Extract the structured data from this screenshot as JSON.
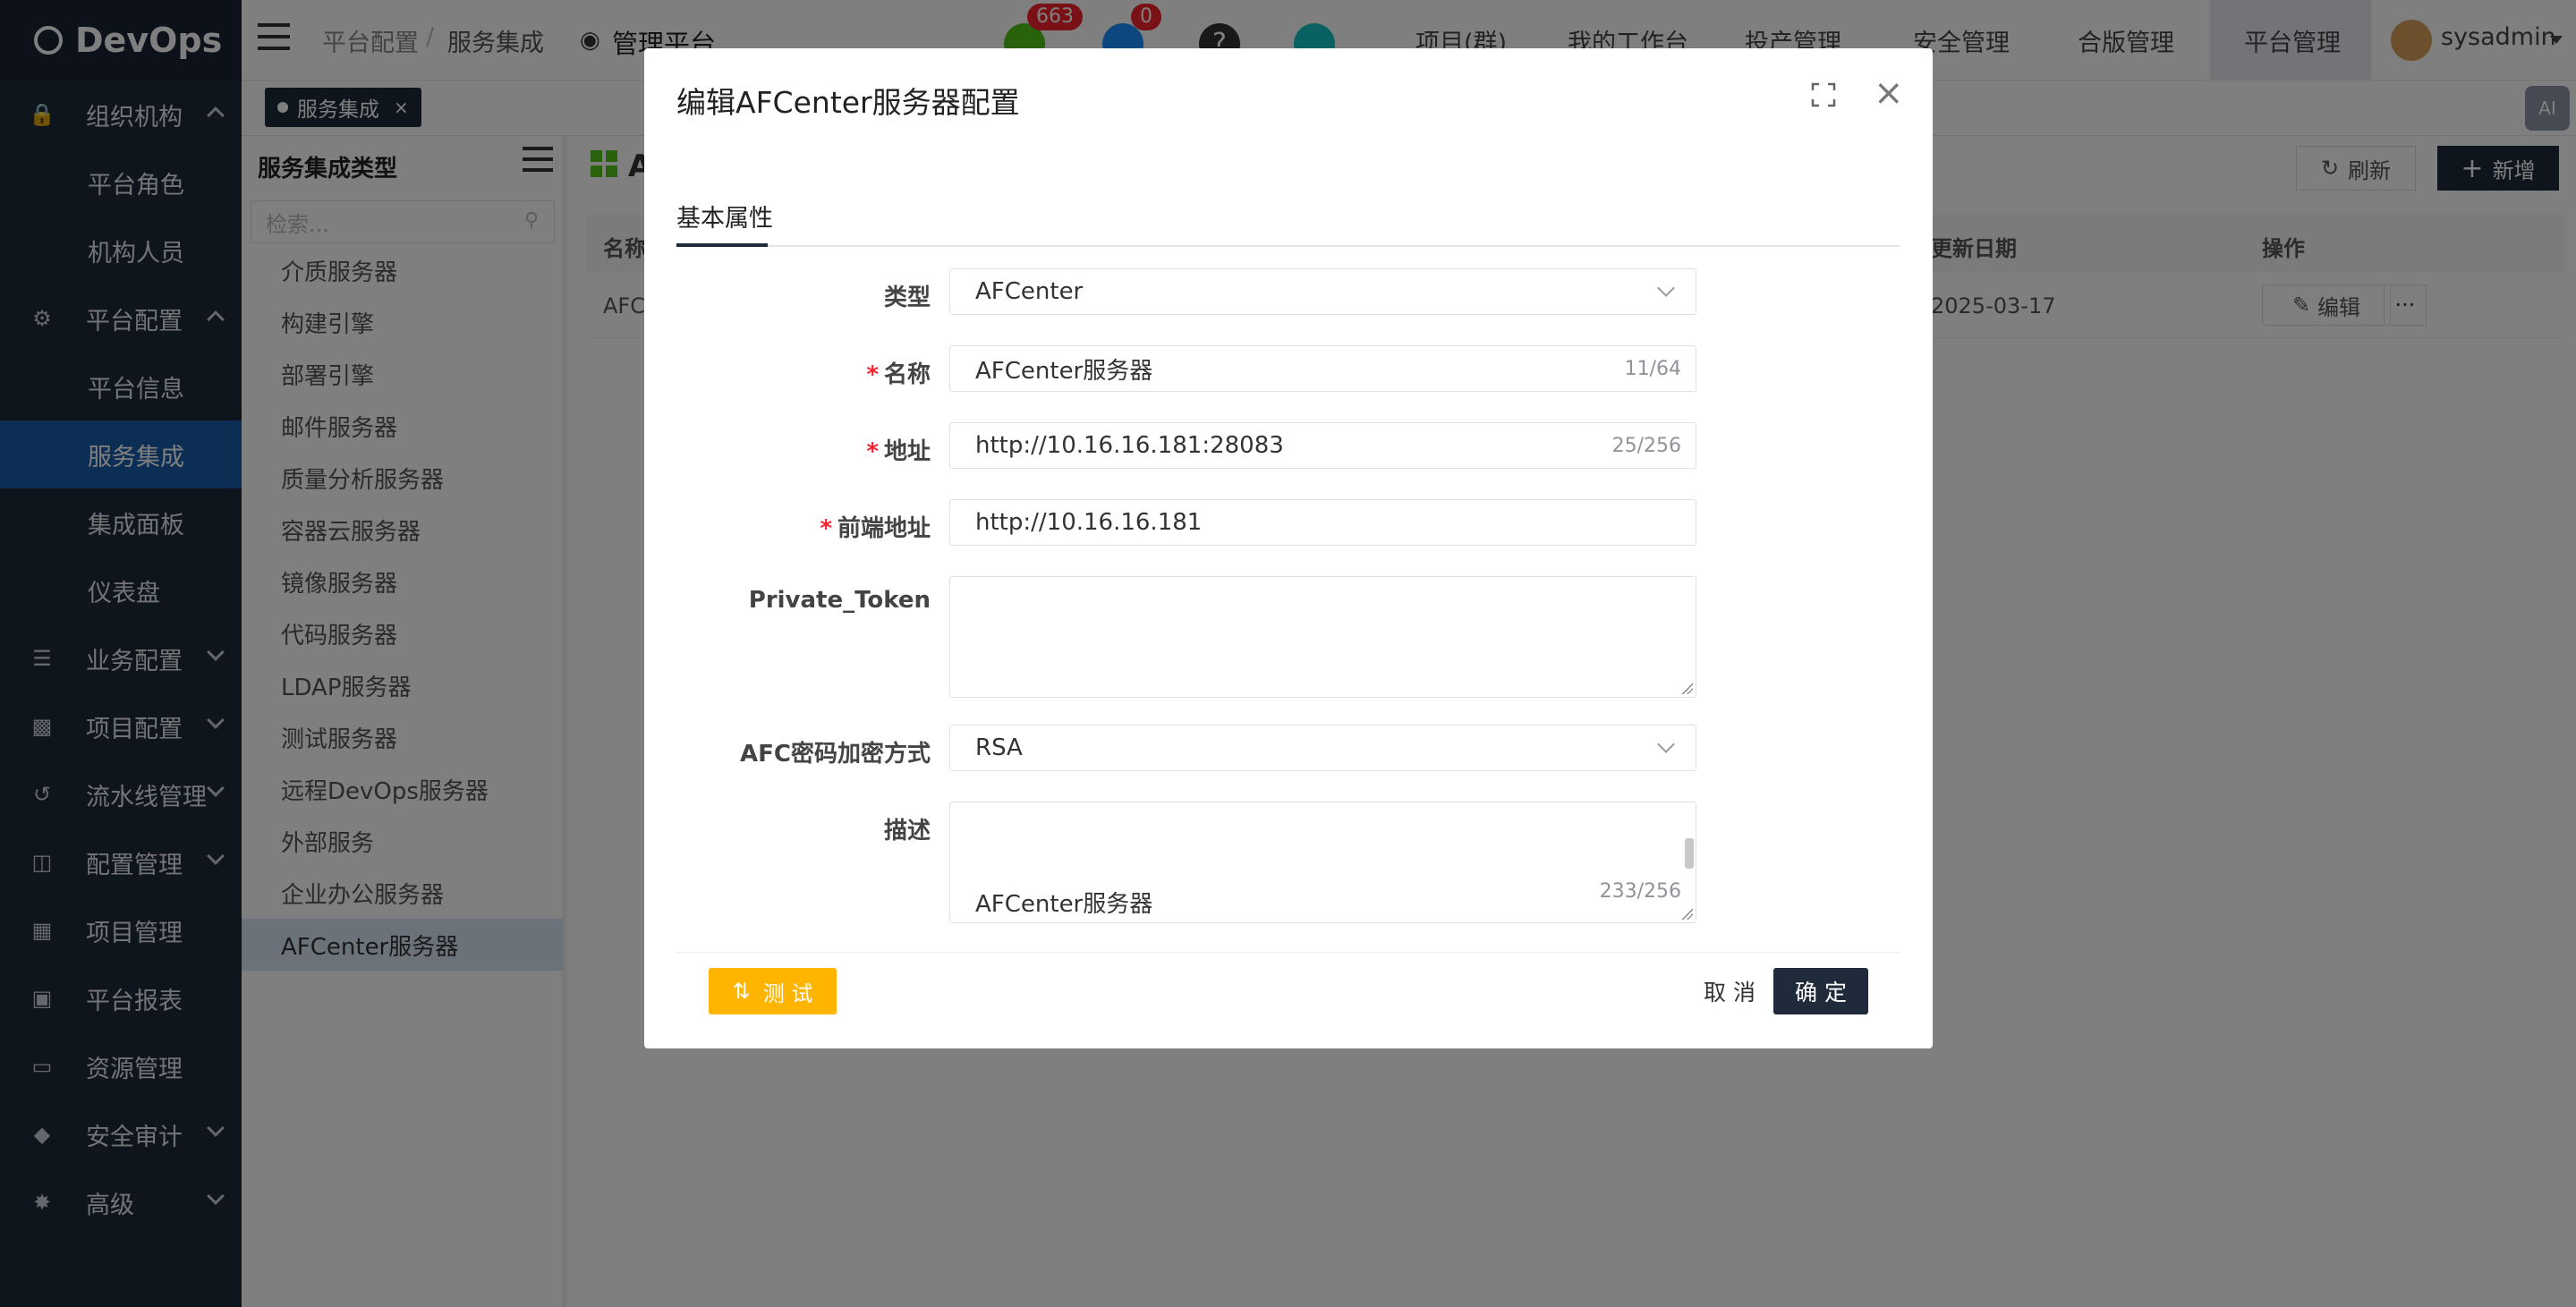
{
  "app": {
    "name": "DevOps",
    "brand_color": "#1f2a3b",
    "accent_color": "#1b5ca8"
  },
  "sidebar": {
    "items": [
      {
        "label": "组织机构",
        "icon": "lock-icon",
        "expanded": true,
        "children": [
          "平台角色",
          "机构人员"
        ]
      },
      {
        "label": "平台配置",
        "icon": "gear-icon",
        "expanded": true,
        "children": [
          "平台信息",
          "服务集成",
          "集成面板",
          "仪表盘"
        ],
        "active_child": "服务集成"
      },
      {
        "label": "业务配置",
        "icon": "sliders-icon",
        "expanded": false
      },
      {
        "label": "项目配置",
        "icon": "project-config-icon",
        "expanded": false
      },
      {
        "label": "流水线管理",
        "icon": "pipeline-icon",
        "expanded": false
      },
      {
        "label": "配置管理",
        "icon": "database-icon",
        "expanded": false
      },
      {
        "label": "项目管理",
        "icon": "grid-icon",
        "expanded": false
      },
      {
        "label": "平台报表",
        "icon": "report-icon",
        "expanded": false
      },
      {
        "label": "资源管理",
        "icon": "folder-icon",
        "expanded": false
      },
      {
        "label": "安全审计",
        "icon": "shield-icon",
        "expanded": false
      },
      {
        "label": "高级",
        "icon": "advanced-icon",
        "expanded": false
      }
    ]
  },
  "header": {
    "breadcrumb": [
      "平台配置",
      "服务集成"
    ],
    "platform_label": "管理平台",
    "badges": {
      "tasks": "663",
      "messages": "0"
    },
    "nav": [
      "项目(群)",
      "我的工作台",
      "投产管理",
      "安全管理",
      "合版管理",
      "平台管理"
    ],
    "active_nav": "平台管理",
    "user": "sysadmin"
  },
  "tabs": [
    {
      "label": "服务集成",
      "close": "×"
    }
  ],
  "left_panel": {
    "title": "服务集成类型",
    "search_placeholder": "检索...",
    "items": [
      "介质服务器",
      "构建引擎",
      "部署引擎",
      "邮件服务器",
      "质量分析服务器",
      "容器云服务器",
      "镜像服务器",
      "代码服务器",
      "LDAP服务器",
      "测试服务器",
      "远程DevOps服务器",
      "外部服务",
      "企业办公服务器",
      "AFCenter服务器"
    ],
    "active_item": "AFCenter服务器"
  },
  "main": {
    "title": "A",
    "refresh_label": "刷新",
    "add_label": "新增",
    "columns": {
      "name": "名称",
      "updated": "更新日期",
      "actions": "操作"
    },
    "rows": [
      {
        "name": "AFC",
        "updated": "2025-03-17",
        "edit": "编辑",
        "more": "···"
      }
    ]
  },
  "modal": {
    "title": "编辑AFCenter服务器配置",
    "tab": "基本属性",
    "fields": {
      "type": {
        "label": "类型",
        "value": "AFCenter"
      },
      "name": {
        "label": "名称",
        "value": "AFCenter服务器",
        "count": "11/64"
      },
      "address": {
        "label": "地址",
        "value": "http://10.16.16.181:28083",
        "count": "25/256"
      },
      "frontend": {
        "label": "前端地址",
        "value": "http://10.16.16.181"
      },
      "token": {
        "label": "Private_Token",
        "value": ""
      },
      "encrypt": {
        "label": "AFC密码加密方式",
        "value": "RSA"
      },
      "desc": {
        "label": "描述",
        "value": "AFCenter服务器",
        "count": "233/256"
      }
    },
    "required_mark": "*",
    "test_label": "测 试",
    "cancel_label": "取 消",
    "ok_label": "确 定",
    "test_color": "#ffb400"
  }
}
